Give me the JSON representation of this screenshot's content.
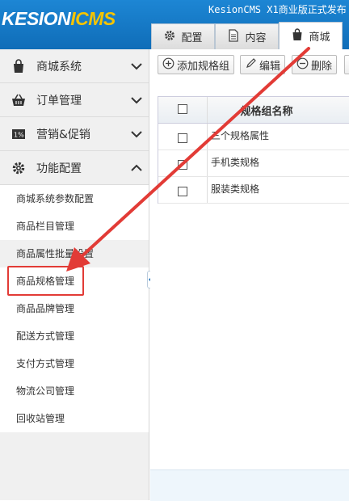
{
  "header": {
    "logo_main": "KESION",
    "logo_accent": "ICMS",
    "notice": "KesionCMS X1商业版正式发布",
    "tabs": [
      {
        "label": "配置",
        "icon": "gear-icon"
      },
      {
        "label": "内容",
        "icon": "document-icon"
      },
      {
        "label": "商城",
        "icon": "shopping-bag-icon",
        "active": true
      }
    ]
  },
  "sidebar": {
    "groups": [
      {
        "label": "商城系统",
        "icon": "shopping-bag-icon",
        "expanded": false
      },
      {
        "label": "订单管理",
        "icon": "basket-icon",
        "expanded": false
      },
      {
        "label": "营销&促销",
        "icon": "promotion-icon",
        "expanded": false
      },
      {
        "label": "功能配置",
        "icon": "gear-icon",
        "expanded": true
      }
    ],
    "items": [
      "商城系统参数配置",
      "商品栏目管理",
      "商品属性批量设置",
      "商品规格管理",
      "商品品牌管理",
      "配送方式管理",
      "支付方式管理",
      "物流公司管理",
      "回收站管理"
    ]
  },
  "toolbar": {
    "add_label": "添加规格组",
    "edit_label": "编辑",
    "delete_label": "删除"
  },
  "table": {
    "header_name": "规格组名称",
    "rows": [
      "三个规格属性",
      "手机类规格",
      "服装类规格"
    ]
  },
  "colors": {
    "header_blue": "#1480cf",
    "logo_accent": "#f5c400",
    "annotation_red": "#e23b36"
  }
}
